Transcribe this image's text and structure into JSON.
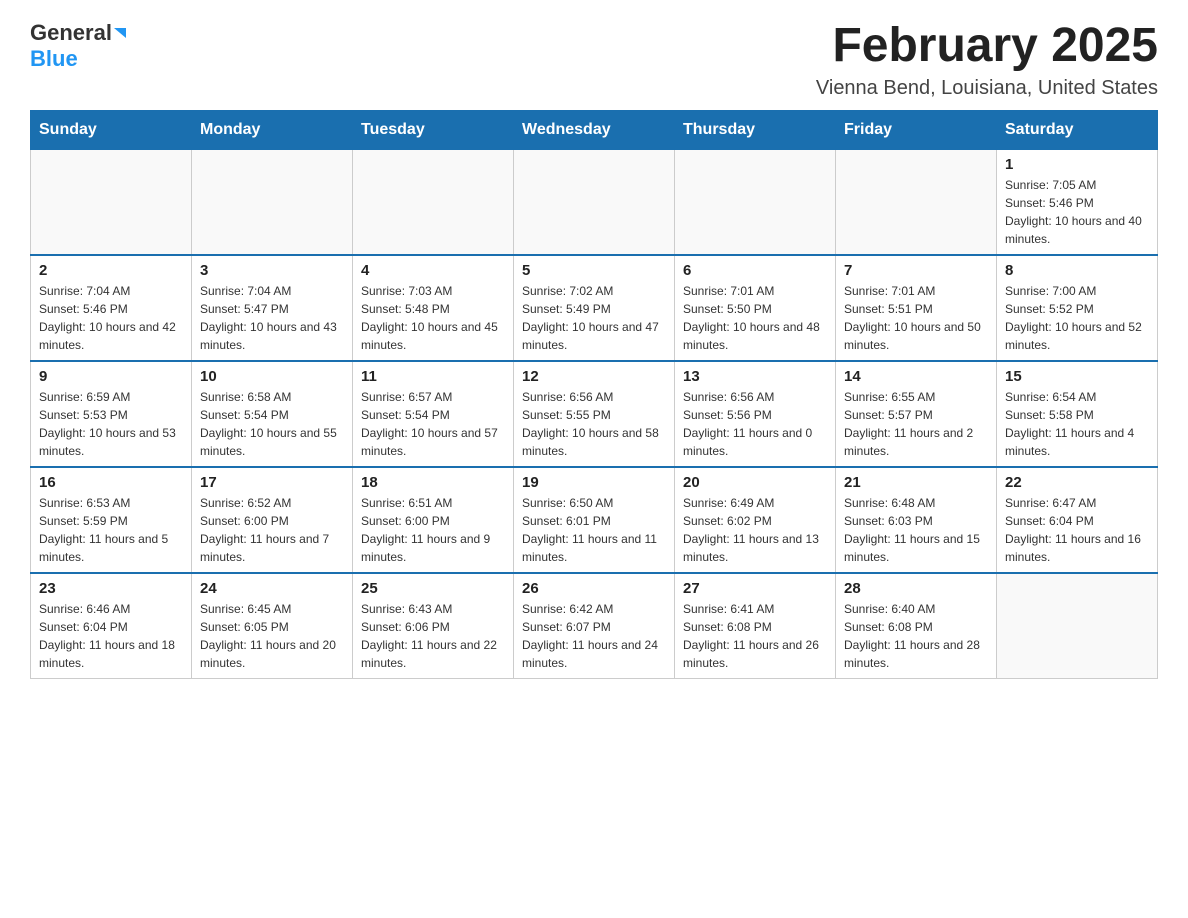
{
  "header": {
    "logo_general": "General",
    "logo_blue": "Blue",
    "month_year": "February 2025",
    "location": "Vienna Bend, Louisiana, United States"
  },
  "days_of_week": [
    "Sunday",
    "Monday",
    "Tuesday",
    "Wednesday",
    "Thursday",
    "Friday",
    "Saturday"
  ],
  "weeks": [
    [
      {
        "day": "",
        "info": ""
      },
      {
        "day": "",
        "info": ""
      },
      {
        "day": "",
        "info": ""
      },
      {
        "day": "",
        "info": ""
      },
      {
        "day": "",
        "info": ""
      },
      {
        "day": "",
        "info": ""
      },
      {
        "day": "1",
        "info": "Sunrise: 7:05 AM\nSunset: 5:46 PM\nDaylight: 10 hours and 40 minutes."
      }
    ],
    [
      {
        "day": "2",
        "info": "Sunrise: 7:04 AM\nSunset: 5:46 PM\nDaylight: 10 hours and 42 minutes."
      },
      {
        "day": "3",
        "info": "Sunrise: 7:04 AM\nSunset: 5:47 PM\nDaylight: 10 hours and 43 minutes."
      },
      {
        "day": "4",
        "info": "Sunrise: 7:03 AM\nSunset: 5:48 PM\nDaylight: 10 hours and 45 minutes."
      },
      {
        "day": "5",
        "info": "Sunrise: 7:02 AM\nSunset: 5:49 PM\nDaylight: 10 hours and 47 minutes."
      },
      {
        "day": "6",
        "info": "Sunrise: 7:01 AM\nSunset: 5:50 PM\nDaylight: 10 hours and 48 minutes."
      },
      {
        "day": "7",
        "info": "Sunrise: 7:01 AM\nSunset: 5:51 PM\nDaylight: 10 hours and 50 minutes."
      },
      {
        "day": "8",
        "info": "Sunrise: 7:00 AM\nSunset: 5:52 PM\nDaylight: 10 hours and 52 minutes."
      }
    ],
    [
      {
        "day": "9",
        "info": "Sunrise: 6:59 AM\nSunset: 5:53 PM\nDaylight: 10 hours and 53 minutes."
      },
      {
        "day": "10",
        "info": "Sunrise: 6:58 AM\nSunset: 5:54 PM\nDaylight: 10 hours and 55 minutes."
      },
      {
        "day": "11",
        "info": "Sunrise: 6:57 AM\nSunset: 5:54 PM\nDaylight: 10 hours and 57 minutes."
      },
      {
        "day": "12",
        "info": "Sunrise: 6:56 AM\nSunset: 5:55 PM\nDaylight: 10 hours and 58 minutes."
      },
      {
        "day": "13",
        "info": "Sunrise: 6:56 AM\nSunset: 5:56 PM\nDaylight: 11 hours and 0 minutes."
      },
      {
        "day": "14",
        "info": "Sunrise: 6:55 AM\nSunset: 5:57 PM\nDaylight: 11 hours and 2 minutes."
      },
      {
        "day": "15",
        "info": "Sunrise: 6:54 AM\nSunset: 5:58 PM\nDaylight: 11 hours and 4 minutes."
      }
    ],
    [
      {
        "day": "16",
        "info": "Sunrise: 6:53 AM\nSunset: 5:59 PM\nDaylight: 11 hours and 5 minutes."
      },
      {
        "day": "17",
        "info": "Sunrise: 6:52 AM\nSunset: 6:00 PM\nDaylight: 11 hours and 7 minutes."
      },
      {
        "day": "18",
        "info": "Sunrise: 6:51 AM\nSunset: 6:00 PM\nDaylight: 11 hours and 9 minutes."
      },
      {
        "day": "19",
        "info": "Sunrise: 6:50 AM\nSunset: 6:01 PM\nDaylight: 11 hours and 11 minutes."
      },
      {
        "day": "20",
        "info": "Sunrise: 6:49 AM\nSunset: 6:02 PM\nDaylight: 11 hours and 13 minutes."
      },
      {
        "day": "21",
        "info": "Sunrise: 6:48 AM\nSunset: 6:03 PM\nDaylight: 11 hours and 15 minutes."
      },
      {
        "day": "22",
        "info": "Sunrise: 6:47 AM\nSunset: 6:04 PM\nDaylight: 11 hours and 16 minutes."
      }
    ],
    [
      {
        "day": "23",
        "info": "Sunrise: 6:46 AM\nSunset: 6:04 PM\nDaylight: 11 hours and 18 minutes."
      },
      {
        "day": "24",
        "info": "Sunrise: 6:45 AM\nSunset: 6:05 PM\nDaylight: 11 hours and 20 minutes."
      },
      {
        "day": "25",
        "info": "Sunrise: 6:43 AM\nSunset: 6:06 PM\nDaylight: 11 hours and 22 minutes."
      },
      {
        "day": "26",
        "info": "Sunrise: 6:42 AM\nSunset: 6:07 PM\nDaylight: 11 hours and 24 minutes."
      },
      {
        "day": "27",
        "info": "Sunrise: 6:41 AM\nSunset: 6:08 PM\nDaylight: 11 hours and 26 minutes."
      },
      {
        "day": "28",
        "info": "Sunrise: 6:40 AM\nSunset: 6:08 PM\nDaylight: 11 hours and 28 minutes."
      },
      {
        "day": "",
        "info": ""
      }
    ]
  ]
}
